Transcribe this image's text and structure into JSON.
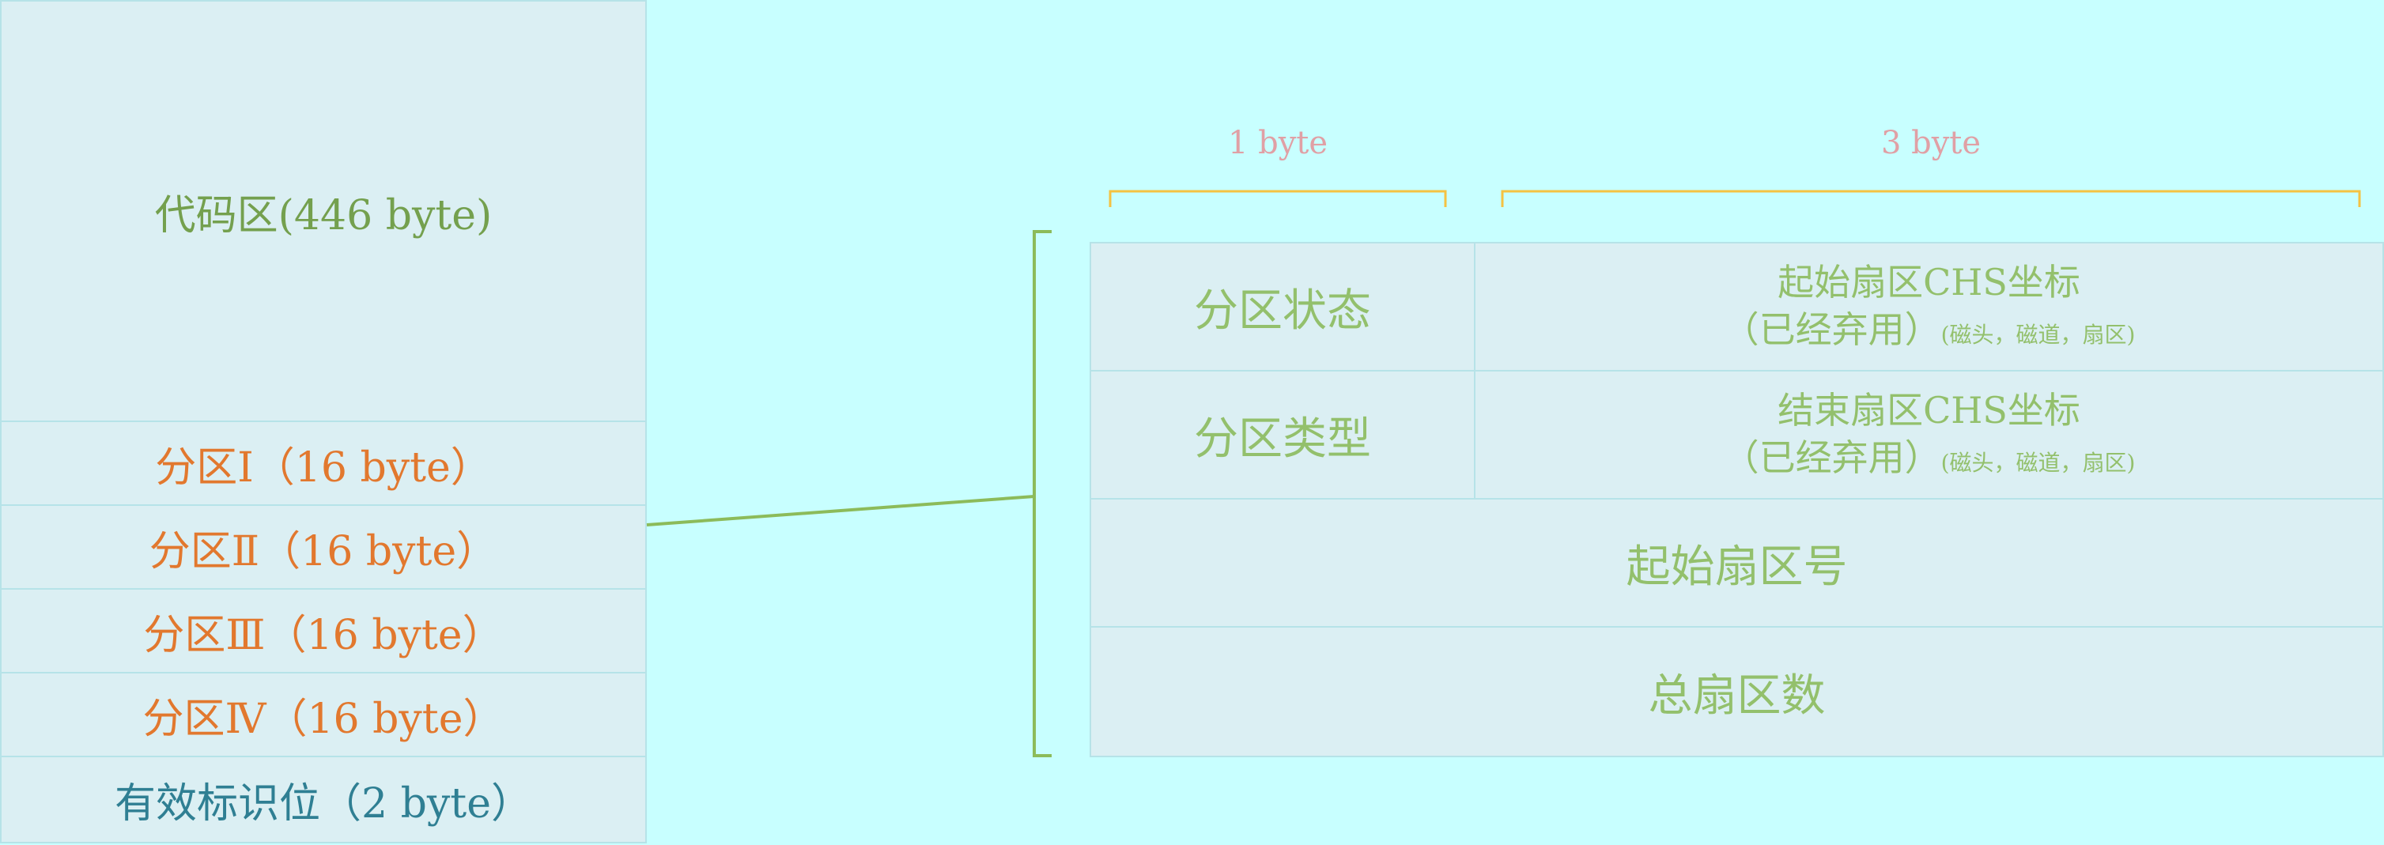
{
  "mbr": {
    "code_area": "代码区(446 byte)",
    "partitions": [
      "分区Ⅰ（16 byte）",
      "分区Ⅱ（16 byte）",
      "分区Ⅲ（16 byte）",
      "分区Ⅳ（16 byte）"
    ],
    "signature": "有效标识位（2 byte）"
  },
  "partition_entry": {
    "byte_labels": [
      "1 byte",
      "3 byte"
    ],
    "status": "分区状态",
    "start_chs": {
      "title": "起始扇区CHS坐标",
      "note": "（已经弃用）",
      "sub": "(磁头，磁道，扇区)"
    },
    "type": "分区类型",
    "end_chs": {
      "title": "结束扇区CHS坐标",
      "note": "（已经弃用）",
      "sub": "(磁头，磁道，扇区)"
    },
    "start_sector": "起始扇区号",
    "total_sectors": "总扇区数"
  },
  "colors": {
    "background": "#c8ffff",
    "cell_fill": "#dbeff3",
    "partition_text": "#e2782e",
    "code_text": "#74a04e",
    "signature_text": "#2f7f93",
    "entry_text": "#93c06c",
    "byte_brace": "#f5c242",
    "connector": "#8cbb5a"
  }
}
